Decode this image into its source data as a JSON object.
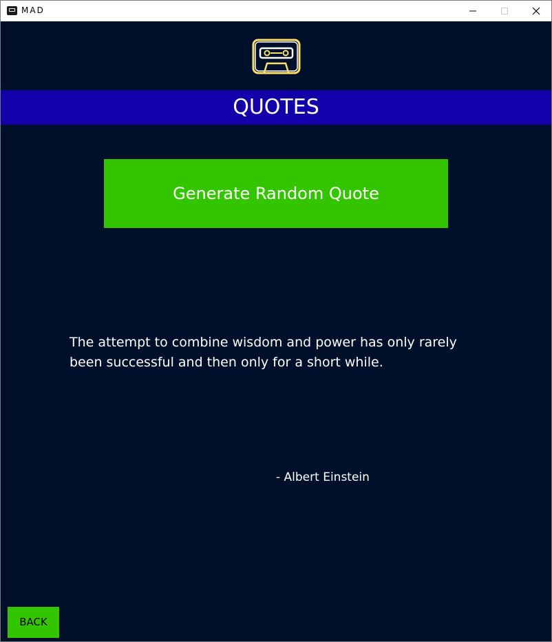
{
  "window": {
    "title": "MAD",
    "app_icon": "cassette-icon",
    "controls": [
      "minimize-icon",
      "maximize-icon",
      "close-icon"
    ]
  },
  "logo": {
    "icon": "cassette-tape-icon",
    "color": "#ffe066"
  },
  "header": {
    "title": "QUOTES",
    "background": "#1201aa"
  },
  "generate_button": {
    "label": "Generate Random Quote",
    "background": "#33c600"
  },
  "quote": {
    "text": "The attempt to combine wisdom and power has only rarely been successful and then only for a short while.",
    "author": "- Albert Einstein"
  },
  "back_button": {
    "label": "BACK",
    "background": "#33c600"
  },
  "colors": {
    "page_background": "#00102b",
    "text": "#ffffff"
  }
}
